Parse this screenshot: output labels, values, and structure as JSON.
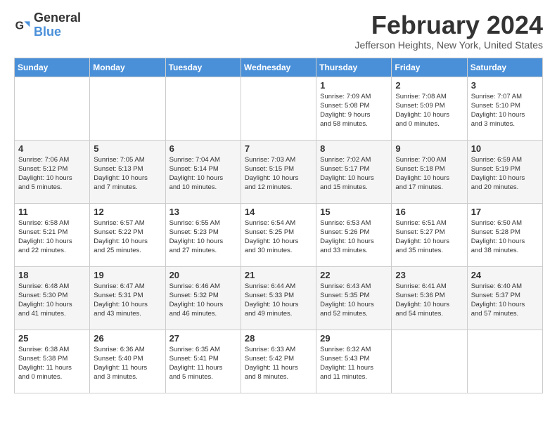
{
  "header": {
    "logo_line1": "General",
    "logo_line2": "Blue",
    "month_title": "February 2024",
    "subtitle": "Jefferson Heights, New York, United States"
  },
  "weekdays": [
    "Sunday",
    "Monday",
    "Tuesday",
    "Wednesday",
    "Thursday",
    "Friday",
    "Saturday"
  ],
  "weeks": [
    {
      "shade": "white",
      "days": [
        {
          "num": "",
          "info": ""
        },
        {
          "num": "",
          "info": ""
        },
        {
          "num": "",
          "info": ""
        },
        {
          "num": "",
          "info": ""
        },
        {
          "num": "1",
          "info": "Sunrise: 7:09 AM\nSunset: 5:08 PM\nDaylight: 9 hours\nand 58 minutes."
        },
        {
          "num": "2",
          "info": "Sunrise: 7:08 AM\nSunset: 5:09 PM\nDaylight: 10 hours\nand 0 minutes."
        },
        {
          "num": "3",
          "info": "Sunrise: 7:07 AM\nSunset: 5:10 PM\nDaylight: 10 hours\nand 3 minutes."
        }
      ]
    },
    {
      "shade": "shade",
      "days": [
        {
          "num": "4",
          "info": "Sunrise: 7:06 AM\nSunset: 5:12 PM\nDaylight: 10 hours\nand 5 minutes."
        },
        {
          "num": "5",
          "info": "Sunrise: 7:05 AM\nSunset: 5:13 PM\nDaylight: 10 hours\nand 7 minutes."
        },
        {
          "num": "6",
          "info": "Sunrise: 7:04 AM\nSunset: 5:14 PM\nDaylight: 10 hours\nand 10 minutes."
        },
        {
          "num": "7",
          "info": "Sunrise: 7:03 AM\nSunset: 5:15 PM\nDaylight: 10 hours\nand 12 minutes."
        },
        {
          "num": "8",
          "info": "Sunrise: 7:02 AM\nSunset: 5:17 PM\nDaylight: 10 hours\nand 15 minutes."
        },
        {
          "num": "9",
          "info": "Sunrise: 7:00 AM\nSunset: 5:18 PM\nDaylight: 10 hours\nand 17 minutes."
        },
        {
          "num": "10",
          "info": "Sunrise: 6:59 AM\nSunset: 5:19 PM\nDaylight: 10 hours\nand 20 minutes."
        }
      ]
    },
    {
      "shade": "white",
      "days": [
        {
          "num": "11",
          "info": "Sunrise: 6:58 AM\nSunset: 5:21 PM\nDaylight: 10 hours\nand 22 minutes."
        },
        {
          "num": "12",
          "info": "Sunrise: 6:57 AM\nSunset: 5:22 PM\nDaylight: 10 hours\nand 25 minutes."
        },
        {
          "num": "13",
          "info": "Sunrise: 6:55 AM\nSunset: 5:23 PM\nDaylight: 10 hours\nand 27 minutes."
        },
        {
          "num": "14",
          "info": "Sunrise: 6:54 AM\nSunset: 5:25 PM\nDaylight: 10 hours\nand 30 minutes."
        },
        {
          "num": "15",
          "info": "Sunrise: 6:53 AM\nSunset: 5:26 PM\nDaylight: 10 hours\nand 33 minutes."
        },
        {
          "num": "16",
          "info": "Sunrise: 6:51 AM\nSunset: 5:27 PM\nDaylight: 10 hours\nand 35 minutes."
        },
        {
          "num": "17",
          "info": "Sunrise: 6:50 AM\nSunset: 5:28 PM\nDaylight: 10 hours\nand 38 minutes."
        }
      ]
    },
    {
      "shade": "shade",
      "days": [
        {
          "num": "18",
          "info": "Sunrise: 6:48 AM\nSunset: 5:30 PM\nDaylight: 10 hours\nand 41 minutes."
        },
        {
          "num": "19",
          "info": "Sunrise: 6:47 AM\nSunset: 5:31 PM\nDaylight: 10 hours\nand 43 minutes."
        },
        {
          "num": "20",
          "info": "Sunrise: 6:46 AM\nSunset: 5:32 PM\nDaylight: 10 hours\nand 46 minutes."
        },
        {
          "num": "21",
          "info": "Sunrise: 6:44 AM\nSunset: 5:33 PM\nDaylight: 10 hours\nand 49 minutes."
        },
        {
          "num": "22",
          "info": "Sunrise: 6:43 AM\nSunset: 5:35 PM\nDaylight: 10 hours\nand 52 minutes."
        },
        {
          "num": "23",
          "info": "Sunrise: 6:41 AM\nSunset: 5:36 PM\nDaylight: 10 hours\nand 54 minutes."
        },
        {
          "num": "24",
          "info": "Sunrise: 6:40 AM\nSunset: 5:37 PM\nDaylight: 10 hours\nand 57 minutes."
        }
      ]
    },
    {
      "shade": "white",
      "days": [
        {
          "num": "25",
          "info": "Sunrise: 6:38 AM\nSunset: 5:38 PM\nDaylight: 11 hours\nand 0 minutes."
        },
        {
          "num": "26",
          "info": "Sunrise: 6:36 AM\nSunset: 5:40 PM\nDaylight: 11 hours\nand 3 minutes."
        },
        {
          "num": "27",
          "info": "Sunrise: 6:35 AM\nSunset: 5:41 PM\nDaylight: 11 hours\nand 5 minutes."
        },
        {
          "num": "28",
          "info": "Sunrise: 6:33 AM\nSunset: 5:42 PM\nDaylight: 11 hours\nand 8 minutes."
        },
        {
          "num": "29",
          "info": "Sunrise: 6:32 AM\nSunset: 5:43 PM\nDaylight: 11 hours\nand 11 minutes."
        },
        {
          "num": "",
          "info": ""
        },
        {
          "num": "",
          "info": ""
        }
      ]
    }
  ]
}
